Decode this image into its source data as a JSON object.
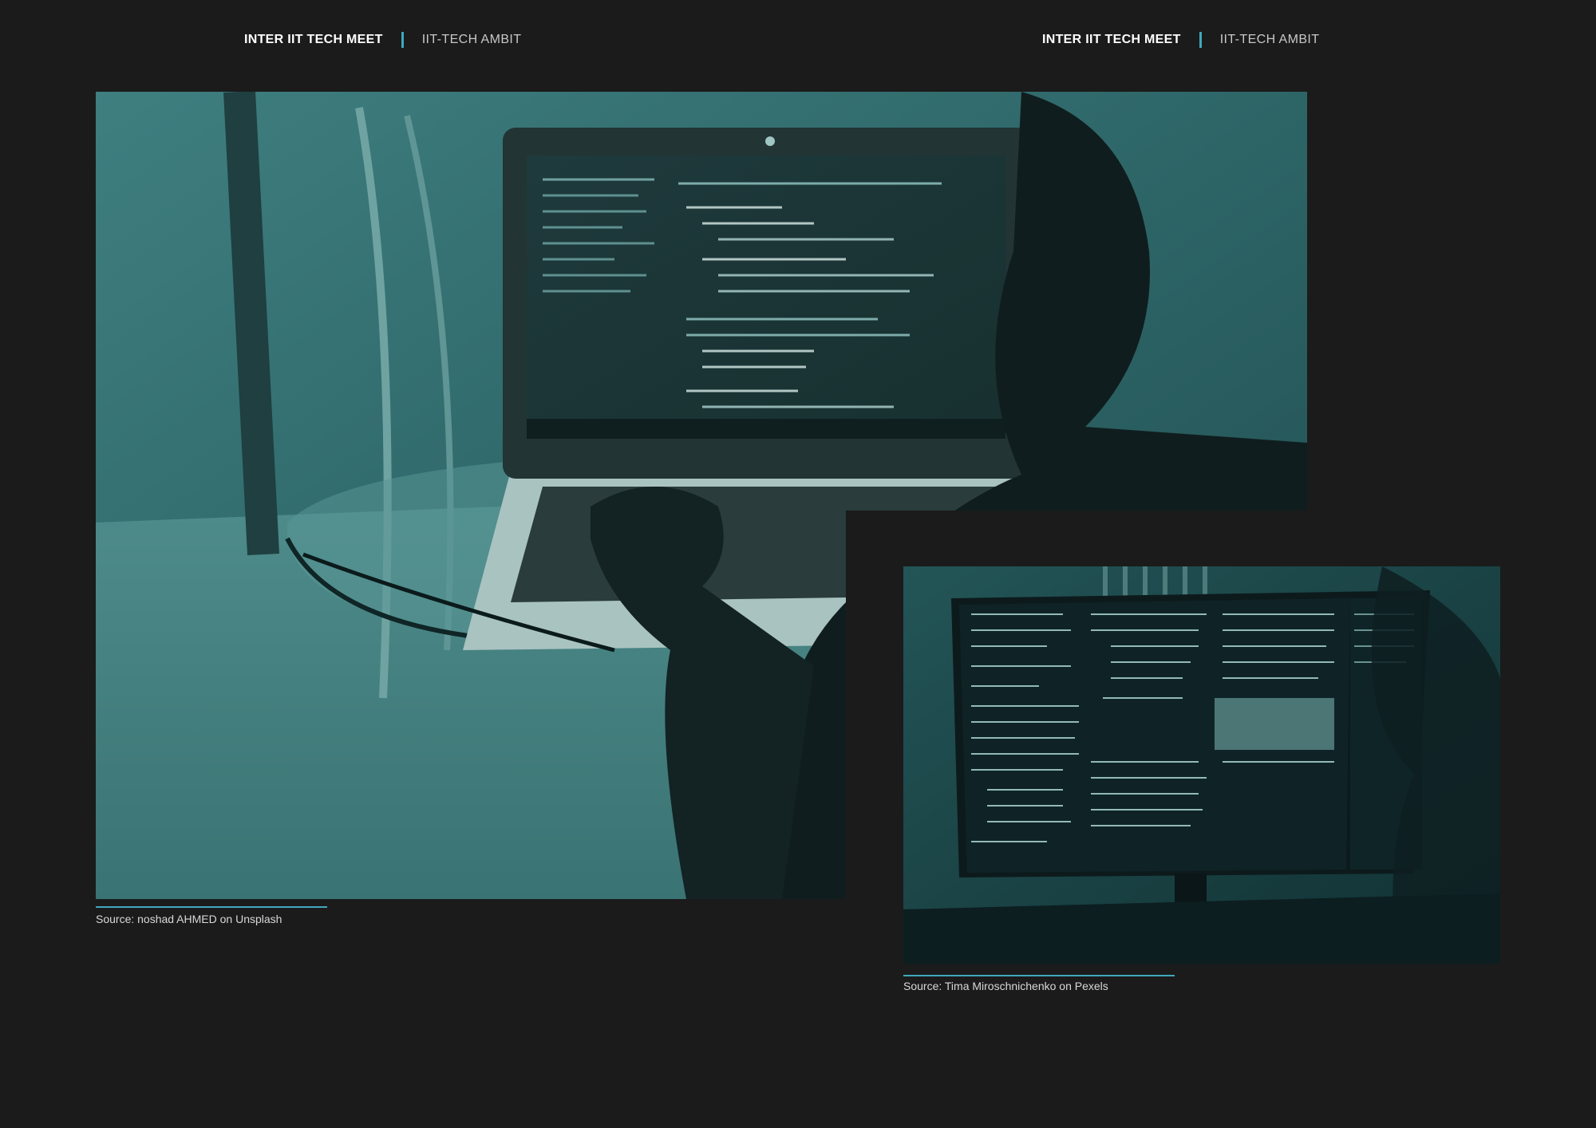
{
  "header_left": {
    "brand": "INTER IIT TECH MEET",
    "subtitle": "IIT-TECH AMBIT"
  },
  "header_right": {
    "brand": "INTER IIT TECH MEET",
    "subtitle": "IIT-TECH AMBIT"
  },
  "photos": [
    {
      "caption": "Source: noshad AHMED on Unsplash",
      "subject": "laptop-with-code-editor-photo"
    },
    {
      "caption": "Source: Tima Miroschnichenko on Pexels",
      "subject": "terminal-monitor-photo"
    }
  ],
  "colors": {
    "background": "#1b1b1b",
    "accent": "#3fa9bd",
    "photo_tint": "#2f6f72"
  }
}
